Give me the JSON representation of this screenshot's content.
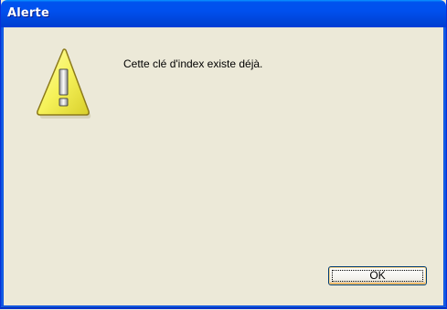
{
  "window": {
    "title": "Alerte"
  },
  "dialog": {
    "icon": "warning-icon",
    "message": "Cette clé d'index existe déjà.",
    "ok_label": "OK"
  },
  "colors": {
    "titlebar": "#0053ee",
    "frame": "#0055e5",
    "background": "#ece9d8",
    "icon_fill": "#fbfb6b",
    "icon_outline": "#8c7a1a"
  }
}
